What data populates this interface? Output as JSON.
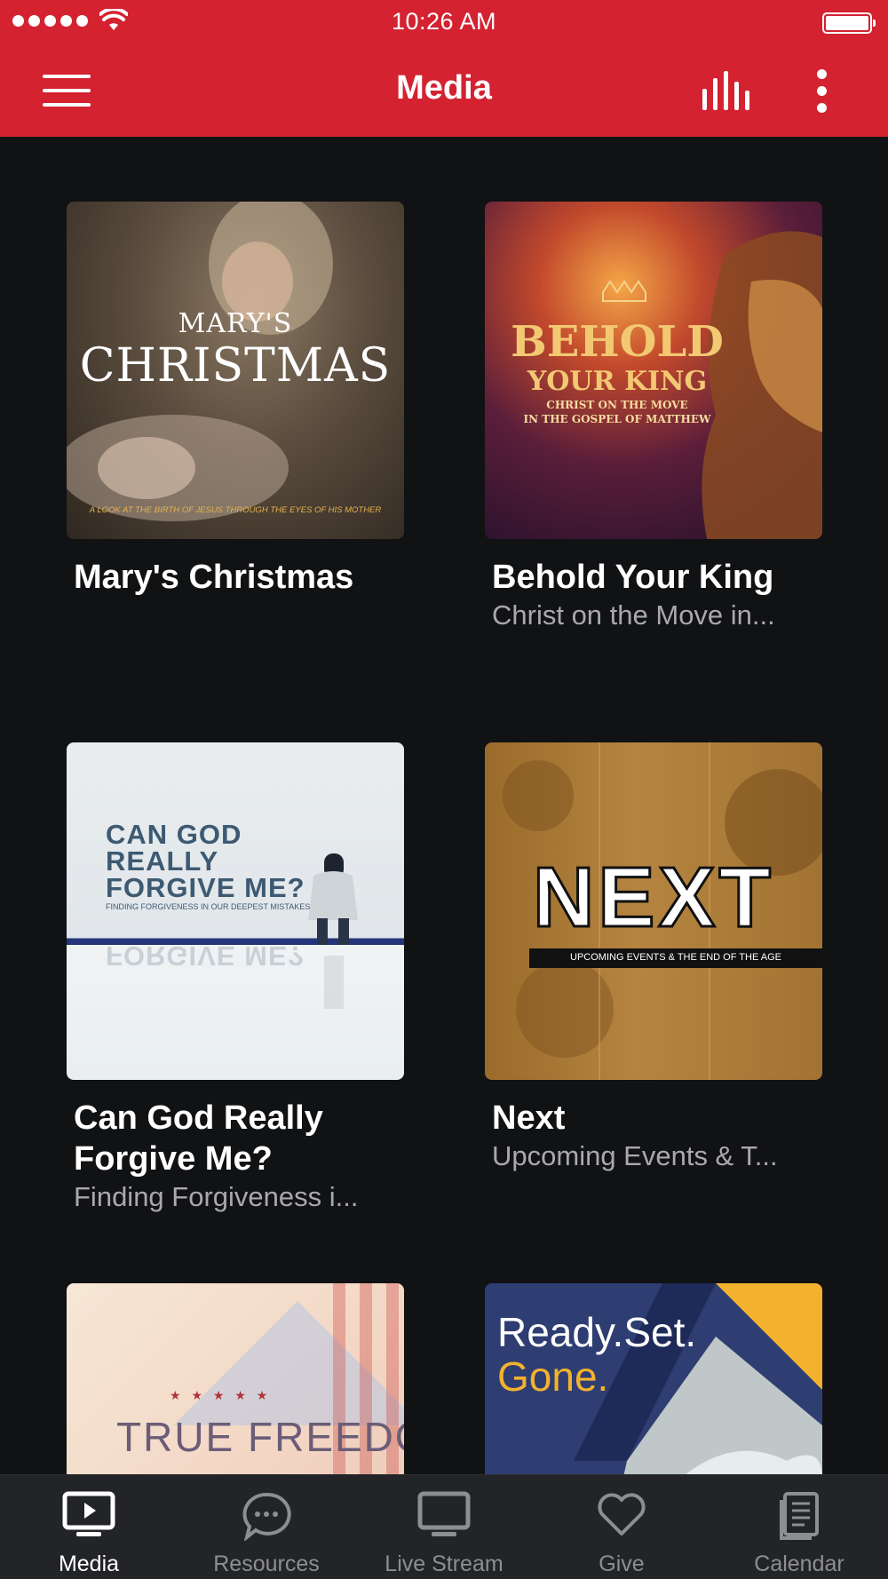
{
  "status_bar": {
    "time": "10:26 AM"
  },
  "header": {
    "title": "Media"
  },
  "items": [
    {
      "title": "Mary's Christmas",
      "subtitle": "",
      "art": {
        "line1": "MARY'S",
        "line2": "CHRISTMAS",
        "tagline": "A LOOK AT THE BIRTH OF JESUS THROUGH THE EYES OF HIS MOTHER"
      }
    },
    {
      "title": "Behold Your King",
      "subtitle": "Christ on the Move in...",
      "art": {
        "line1": "BEHOLD",
        "line2": "YOUR KING",
        "tagline1": "CHRIST ON THE MOVE",
        "tagline2": "IN THE GOSPEL OF MATTHEW"
      }
    },
    {
      "title": "Can God Really Forgive Me?",
      "subtitle": "Finding Forgiveness i...",
      "art": {
        "line1": "CAN GOD",
        "line2": "REALLY",
        "line3": "FORGIVE ME?",
        "tagline": "FINDING FORGIVENESS IN OUR DEEPEST MISTAKES"
      }
    },
    {
      "title": "Next",
      "subtitle": "Upcoming Events & T...",
      "art": {
        "word": "NEXT",
        "tagline": "UPCOMING EVENTS & THE END OF THE AGE"
      }
    },
    {
      "title": "",
      "subtitle": "",
      "art": {
        "word": "TRUE FREEDOM",
        "stars": "★ ★ ★ ★ ★"
      }
    },
    {
      "title": "",
      "subtitle": "",
      "art": {
        "line1": "Ready.Set.",
        "line2": "Gone."
      }
    }
  ],
  "tabs": [
    {
      "label": "Media",
      "icon": "media-icon",
      "active": true
    },
    {
      "label": "Resources",
      "icon": "chat-bubble-icon",
      "active": false
    },
    {
      "label": "Live Stream",
      "icon": "tv-icon",
      "active": false
    },
    {
      "label": "Give",
      "icon": "heart-icon",
      "active": false
    },
    {
      "label": "Calendar",
      "icon": "calendar-icon",
      "active": false
    }
  ],
  "colors": {
    "header": "#d42231",
    "background": "#111214",
    "tabbar": "#232427",
    "subtitle": "#a9a9ad"
  }
}
